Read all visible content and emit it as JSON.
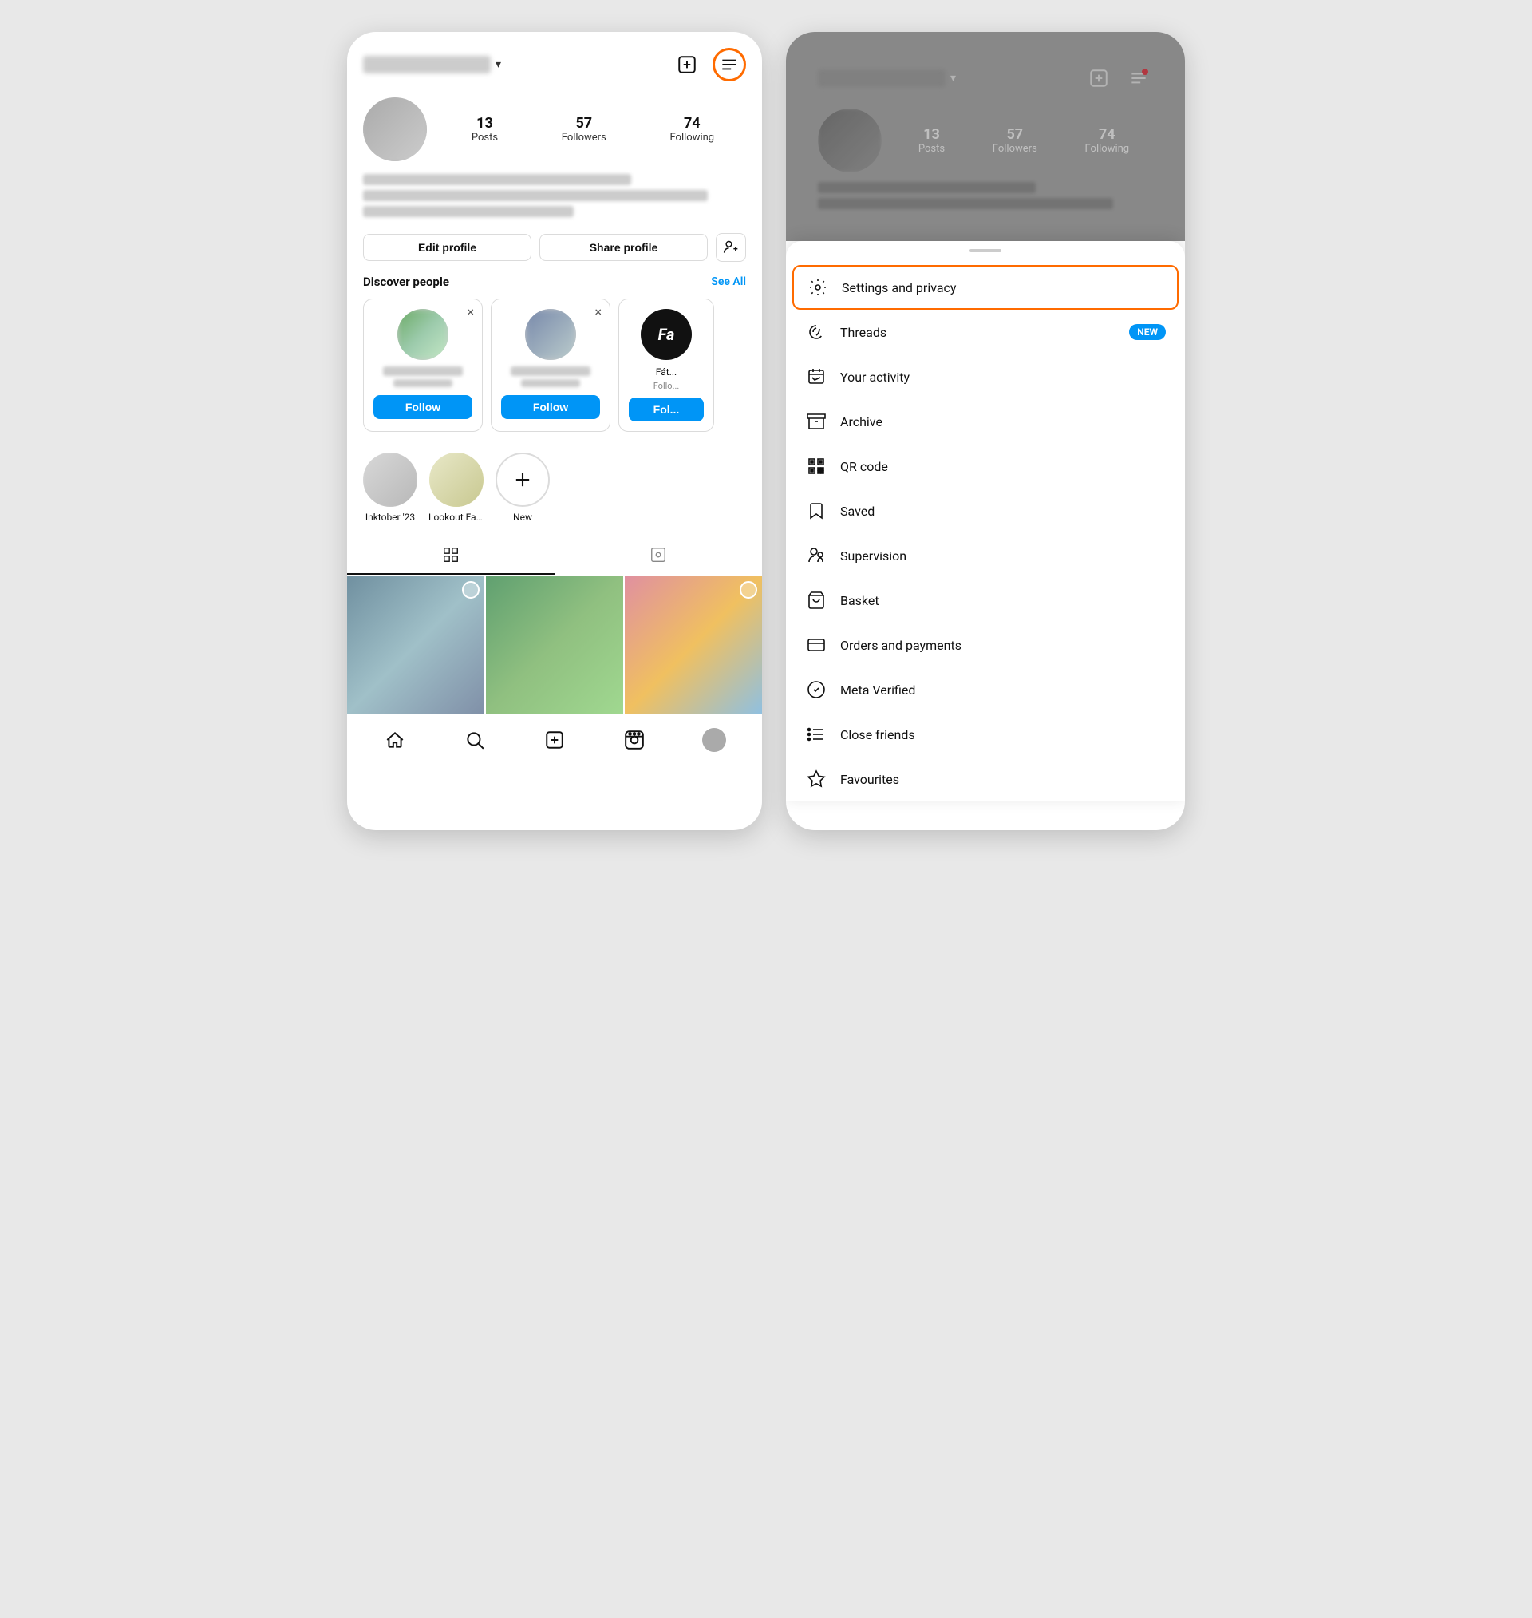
{
  "left_phone": {
    "username": "username",
    "chevron": "▾",
    "stats": {
      "posts_count": "13",
      "posts_label": "Posts",
      "followers_count": "57",
      "followers_label": "Followers",
      "following_count": "74",
      "following_label": "Following"
    },
    "buttons": {
      "edit_profile": "Edit profile",
      "share_profile": "Share profile"
    },
    "discover": {
      "title": "Discover people",
      "see_all": "See All",
      "cards": [
        {
          "follow": "Follow"
        },
        {
          "follow": "Follow"
        },
        {
          "sub": "Follo...",
          "follow": "Fol..."
        }
      ]
    },
    "stories": [
      {
        "label": "Inktober '23"
      },
      {
        "label": "Lookout Fair '..."
      },
      {
        "label": "New"
      }
    ],
    "bottom_nav": {
      "home": "home",
      "search": "search",
      "add": "add",
      "reels": "reels",
      "profile": "profile"
    }
  },
  "right_phone": {
    "username": "username",
    "stats": {
      "posts_count": "13",
      "posts_label": "Posts",
      "followers_count": "57",
      "followers_label": "Followers",
      "following_count": "74",
      "following_label": "Following"
    },
    "menu": {
      "handle": "",
      "items": [
        {
          "id": "settings",
          "label": "Settings and privacy",
          "icon": "settings",
          "highlighted": true
        },
        {
          "id": "threads",
          "label": "Threads",
          "icon": "threads",
          "badge": "NEW"
        },
        {
          "id": "activity",
          "label": "Your activity",
          "icon": "activity"
        },
        {
          "id": "archive",
          "label": "Archive",
          "icon": "archive"
        },
        {
          "id": "qrcode",
          "label": "QR code",
          "icon": "qr"
        },
        {
          "id": "saved",
          "label": "Saved",
          "icon": "saved"
        },
        {
          "id": "supervision",
          "label": "Supervision",
          "icon": "supervision"
        },
        {
          "id": "basket",
          "label": "Basket",
          "icon": "basket"
        },
        {
          "id": "orders",
          "label": "Orders and payments",
          "icon": "orders"
        },
        {
          "id": "meta",
          "label": "Meta Verified",
          "icon": "meta"
        },
        {
          "id": "friends",
          "label": "Close friends",
          "icon": "friends"
        },
        {
          "id": "favourites",
          "label": "Favourites",
          "icon": "favourites"
        }
      ]
    }
  }
}
